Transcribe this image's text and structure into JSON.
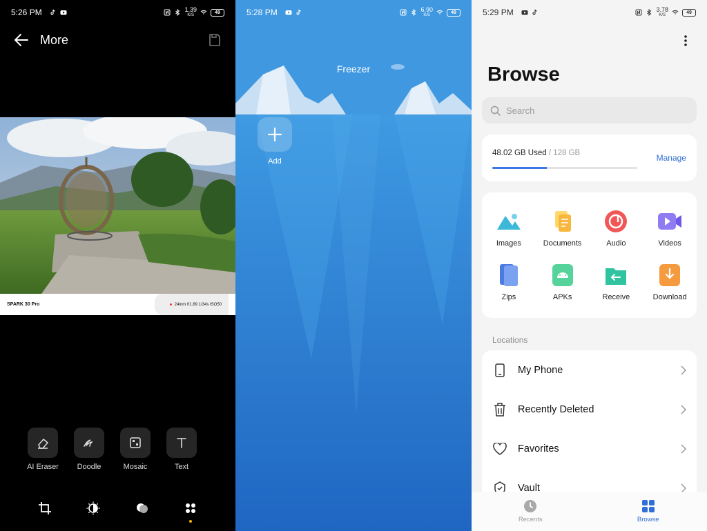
{
  "editor": {
    "status": {
      "time": "5:26 PM",
      "speed": "1.39",
      "speed_unit": "K/S",
      "battery": "49"
    },
    "header": {
      "title": "More"
    },
    "photo_footer": {
      "brand": "SPARK 30 Pro",
      "meta": "24mm f/1.89 1/34s ISO50"
    },
    "tools": [
      {
        "label": "AI Eraser",
        "icon": "eraser-icon"
      },
      {
        "label": "Doodle",
        "icon": "doodle-icon"
      },
      {
        "label": "Mosaic",
        "icon": "mosaic-icon"
      },
      {
        "label": "Text",
        "icon": "text-icon"
      }
    ],
    "bottom_tabs": [
      "crop-icon",
      "adjust-icon",
      "filter-icon",
      "more-icon"
    ],
    "active_dot_color": "#f5b400"
  },
  "freezer": {
    "status": {
      "time": "5:28 PM",
      "speed": "6.90",
      "speed_unit": "K/S",
      "battery": "49"
    },
    "title": "Freezer",
    "add_label": "Add",
    "colors": {
      "sky": "#3f98e0",
      "sea_top": "#3f9ae2",
      "sea_bottom": "#1f66c2"
    }
  },
  "files": {
    "status": {
      "time": "5:29 PM",
      "speed": "3.78",
      "speed_unit": "K/S",
      "battery": "49"
    },
    "title": "Browse",
    "search": {
      "placeholder": "Search"
    },
    "storage": {
      "used": "48.02 GB Used",
      "total": " / 128 GB",
      "manage": "Manage",
      "fill_fraction": 0.375
    },
    "categories": [
      {
        "label": "Images",
        "icon": "images-icon"
      },
      {
        "label": "Documents",
        "icon": "documents-icon"
      },
      {
        "label": "Audio",
        "icon": "audio-icon"
      },
      {
        "label": "Videos",
        "icon": "videos-icon"
      },
      {
        "label": "Zips",
        "icon": "zips-icon"
      },
      {
        "label": "APKs",
        "icon": "apks-icon"
      },
      {
        "label": "Receive",
        "icon": "receive-icon"
      },
      {
        "label": "Download",
        "icon": "download-icon"
      }
    ],
    "locations_header": "Locations",
    "locations": [
      {
        "label": "My Phone",
        "icon": "phone-icon"
      },
      {
        "label": "Recently Deleted",
        "icon": "trash-icon"
      },
      {
        "label": "Favorites",
        "icon": "heart-icon"
      },
      {
        "label": "Vault",
        "icon": "vault-icon"
      }
    ],
    "nav": [
      {
        "label": "Recents",
        "icon": "clock-icon",
        "active": false
      },
      {
        "label": "Browse",
        "icon": "grid-icon",
        "active": true
      }
    ],
    "accent": "#2f6fd6"
  }
}
